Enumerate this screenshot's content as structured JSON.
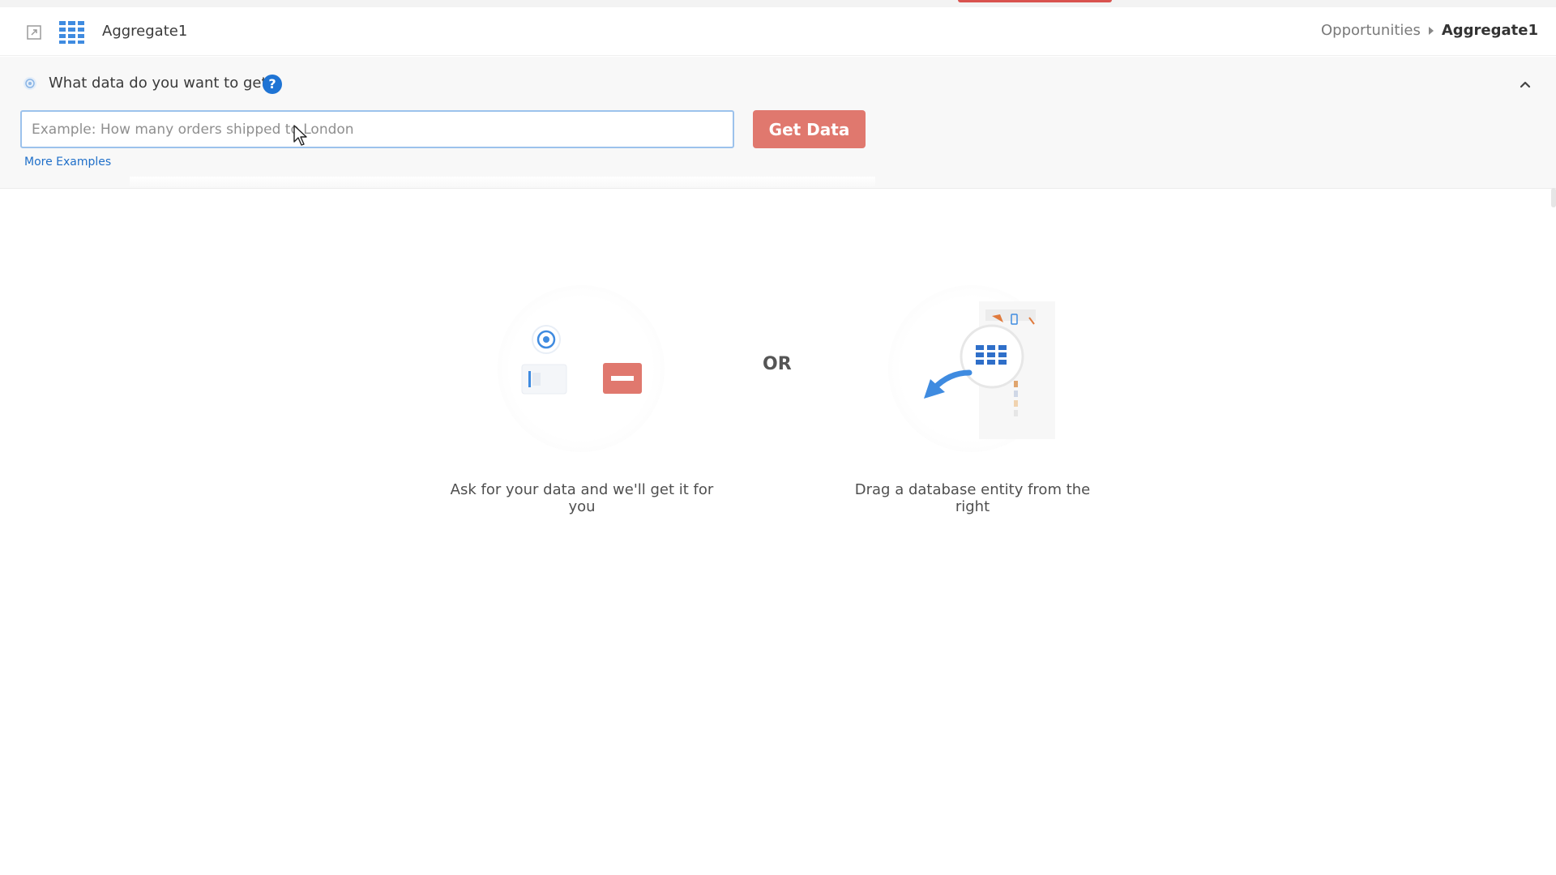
{
  "header": {
    "title": "Aggregate1",
    "breadcrumb": {
      "parent": "Opportunities",
      "current": "Aggregate1"
    }
  },
  "query": {
    "question": "What data do you want to get?",
    "help_symbol": "?",
    "input_placeholder": "Example: How many orders shipped to London",
    "get_data_label": "Get Data",
    "more_examples_label": "More Examples"
  },
  "empty_state": {
    "ask_caption": "Ask for your data and we'll get it for you",
    "or_label": "OR",
    "drag_caption": "Drag a database entity from the right"
  },
  "icons": {
    "open": "open-external-icon",
    "aggregate": "table-grid-icon",
    "ask": "target-icon",
    "help": "help-icon",
    "collapse": "chevron-up-icon",
    "cursor": "mouse-pointer-icon"
  },
  "colors": {
    "primary_blue": "#1f74d4",
    "grid_blue": "#3f8be0",
    "get_data_button": "#e0786e",
    "link": "#1f6fc9",
    "input_border": "#9cc2ec",
    "top_accent": "#d9534f"
  }
}
